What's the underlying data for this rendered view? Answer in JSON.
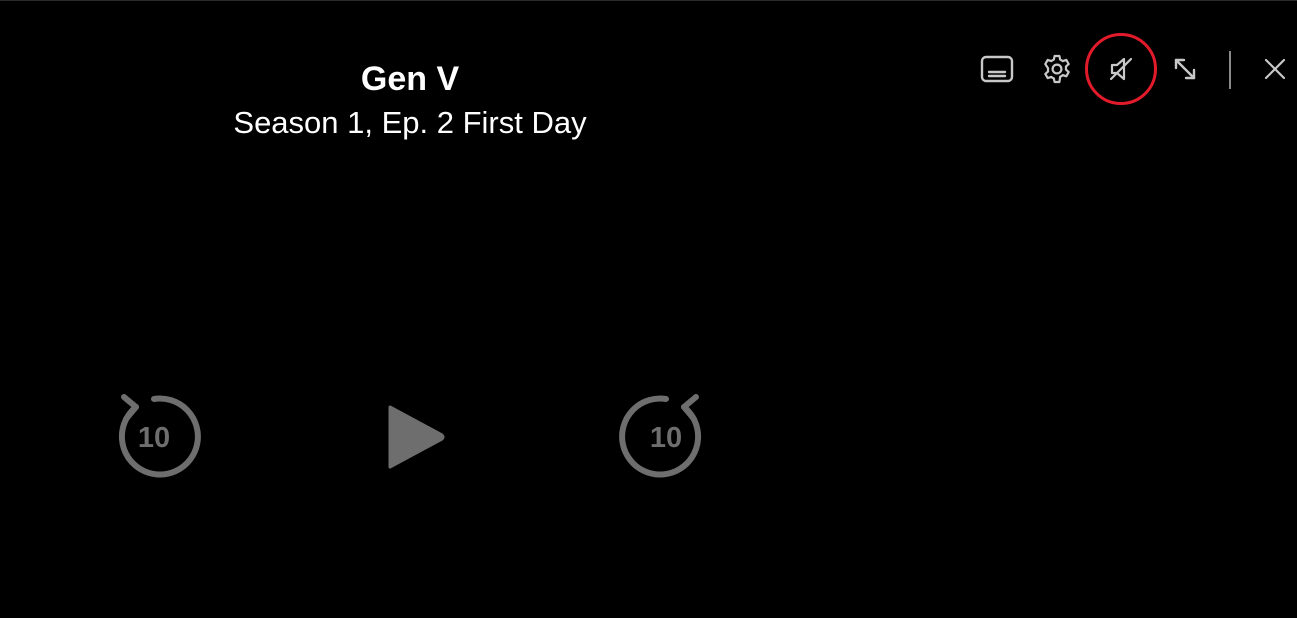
{
  "title": {
    "show": "Gen V",
    "episode": "Season 1, Ep. 2 First Day"
  },
  "top_controls": {
    "subtitles": {
      "icon": "subtitles-icon"
    },
    "settings": {
      "icon": "gear-icon"
    },
    "volume": {
      "icon": "volume-muted-icon",
      "state": "muted",
      "highlighted": true
    },
    "fullscreen": {
      "icon": "expand-arrows-icon"
    },
    "close": {
      "icon": "close-icon"
    }
  },
  "center_controls": {
    "rewind": {
      "icon": "rewind-10-icon",
      "label": "10"
    },
    "play": {
      "icon": "play-icon"
    },
    "forward": {
      "icon": "forward-10-icon",
      "label": "10"
    }
  },
  "colors": {
    "background": "#000000",
    "text": "#ffffff",
    "icon_top": "#c8c8c8",
    "icon_center": "#6e6e6e",
    "highlight": "#e21b2b"
  }
}
